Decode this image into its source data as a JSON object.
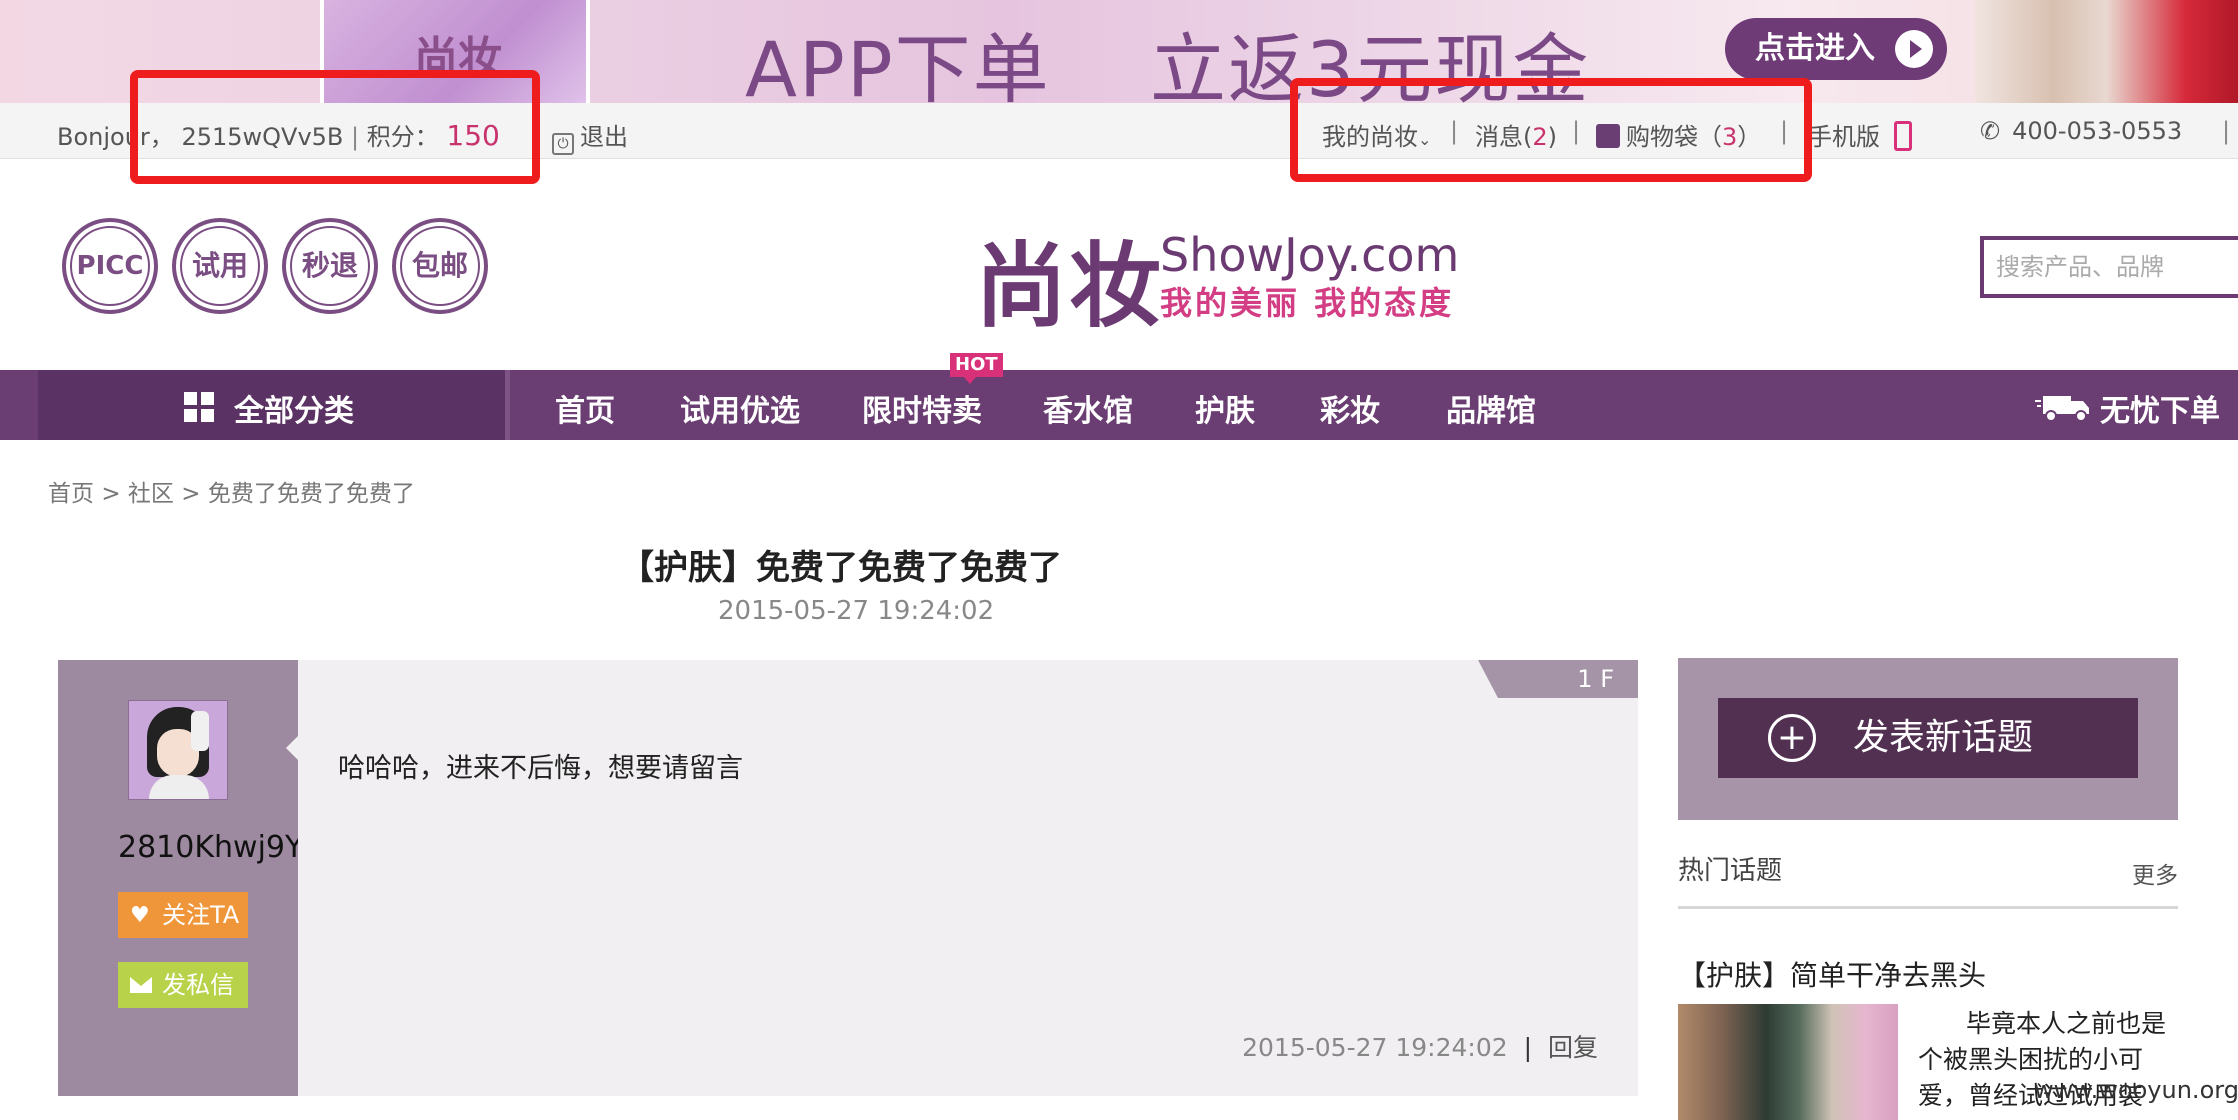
{
  "banner": {
    "phone_text": "尚妆",
    "app_text": "APP下单",
    "promo_text": "立返3元现金",
    "enter_button": "点击进入"
  },
  "topbar": {
    "greeting": "Bonjour",
    "comma": "，",
    "username": "2515wQVv5B",
    "points_label": "积分：",
    "points": "150",
    "logout": "退出",
    "my_showjoy": "我的尚妆",
    "messages_label": "消息(",
    "messages_count": "2",
    "messages_close": ")",
    "bag_label": "购物袋（",
    "bag_count": "3",
    "bag_close": "）",
    "mobile": "手机版",
    "phone": "400-053-0553",
    "separator": "|"
  },
  "badges": [
    "PICC",
    "试用",
    "秒退",
    "包邮"
  ],
  "logo": {
    "cn": "尚妆",
    "en": "ShowJoy.com",
    "slogan": "我的美丽 我的态度"
  },
  "search": {
    "placeholder": "搜索产品、品牌"
  },
  "nav": {
    "all_categories": "全部分类",
    "items": [
      "首页",
      "试用优选",
      "限时特卖",
      "香水馆",
      "护肤",
      "彩妆",
      "品牌馆"
    ],
    "hot_badge": "HOT",
    "worry_free": "无忧下单"
  },
  "breadcrumb": {
    "home": "首页",
    "community": "社区",
    "current": "免费了免费了免费了",
    "sep": ">"
  },
  "post": {
    "title": "【护肤】免费了免费了免费了",
    "time": "2015-05-27 19:24:02",
    "floor": "1 F",
    "author": "2810Khwj9Y",
    "follow": "关注TA",
    "private_message": "发私信",
    "content": "哈哈哈，进来不后悔，想要请留言",
    "footer_time": "2015-05-27 19:24:02",
    "reply": "回复"
  },
  "sidebar": {
    "new_topic": "发表新话题",
    "hot_topics": "热门话题",
    "more": "更多",
    "hot_item_title": "【护肤】简单干净去黑头",
    "hot_item_excerpt": "毕竟本人之前也是个被黑头困扰的小可爱，曾经试过试用装"
  },
  "watermark": "www.wooyun.org",
  "colors": {
    "brand_purple": "#6a3e72",
    "accent_pink": "#c8336e",
    "highlight_red": "#ee1c1c"
  }
}
